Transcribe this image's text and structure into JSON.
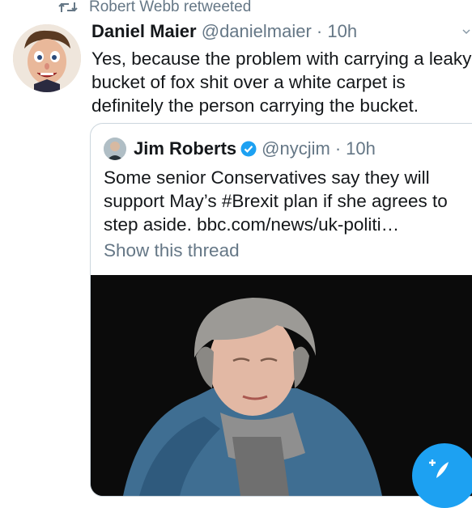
{
  "retweet": {
    "label": "Robert Webb retweeted",
    "icon": "retweet-icon"
  },
  "tweet": {
    "author_name": "Daniel Maier",
    "handle": "@danielmaier",
    "separator": "·",
    "time": "10h",
    "text": "Yes, because the problem with carrying a leaky bucket of fox shit over a white carpet is definitely the person carrying the bucket."
  },
  "quoted": {
    "author_name": "Jim Roberts",
    "verified": true,
    "handle": "@nycjim",
    "separator": "·",
    "time": "10h",
    "text": "Some senior Conservatives say they will support May’s #Brexit plan if she agrees to step aside. bbc.com/news/uk-politi…",
    "show_thread": "Show this thread"
  },
  "compose_button": {
    "icon": "compose-tweet-icon"
  },
  "colors": {
    "accent": "#1da1f2",
    "muted": "#657786",
    "text": "#14171a",
    "border": "#ccd6dd"
  }
}
